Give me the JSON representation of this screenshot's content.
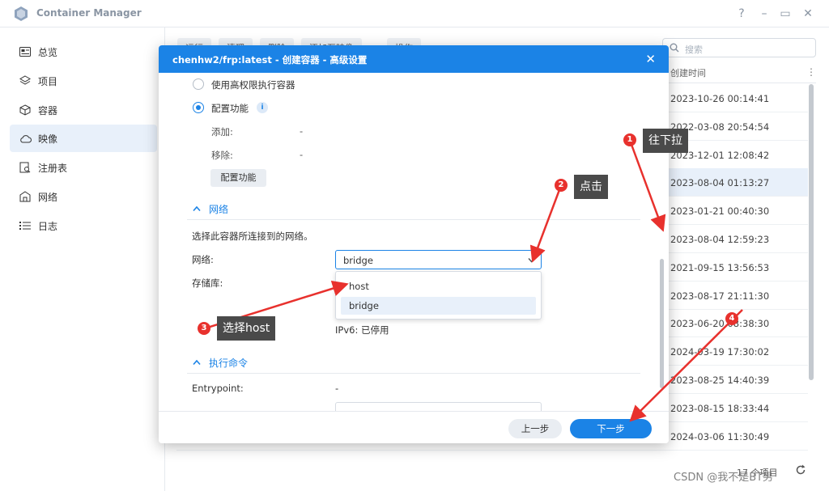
{
  "window": {
    "title": "Container Manager",
    "controls": [
      "?",
      "–",
      "▭",
      "✕"
    ]
  },
  "sidebar": {
    "items": [
      {
        "label": "总览",
        "icon": "overview-icon"
      },
      {
        "label": "项目",
        "icon": "layers-icon"
      },
      {
        "label": "容器",
        "icon": "cube-icon"
      },
      {
        "label": "映像",
        "icon": "cloud-icon"
      },
      {
        "label": "注册表",
        "icon": "registry-icon"
      },
      {
        "label": "网络",
        "icon": "network-icon"
      },
      {
        "label": "日志",
        "icon": "list-icon"
      }
    ],
    "active_index": 3
  },
  "toolbar": {
    "buttons": [
      "运行",
      "清理",
      "删除",
      "添加至映像",
      "操作"
    ]
  },
  "search": {
    "placeholder": "搜索"
  },
  "table": {
    "column_header": "创建时间",
    "more": "⋮",
    "rows": [
      "2023-10-26 00:14:41",
      "2022-03-08 20:54:54",
      "2023-12-01 12:08:42",
      "2023-08-04 01:13:27",
      "2023-01-21 00:40:30",
      "2023-08-04 12:59:23",
      "2021-09-15 13:56:53",
      "2023-08-17 21:11:30",
      "2023-06-20 08:38:30",
      "2024-03-19 17:30:02",
      "2023-08-25 14:40:39",
      "2023-08-15 18:33:44",
      "2024-03-06 11:30:49"
    ],
    "selected_row": 3,
    "footer": "17 个项目"
  },
  "dialog": {
    "title": "chenhw2/frp:latest - 创建容器 - 高级设置",
    "close": "✕",
    "privileged_label": "使用高权限执行容器",
    "capabilities_label": "配置功能",
    "add_label": "添加:",
    "add_value": "-",
    "remove_label": "移除:",
    "remove_value": "-",
    "capabilities_button": "配置功能",
    "network_section": "网络",
    "network_desc": "选择此容器所连接到的网络。",
    "network_label": "网络:",
    "network_value": "bridge",
    "options": [
      "host",
      "bridge"
    ],
    "storage_label": "存储库:",
    "ipv6": "IPv6: 已停用",
    "exec_section": "执行命令",
    "entrypoint_label": "Entrypoint:",
    "entrypoint_value": "-",
    "prev_button": "上一步",
    "next_button": "下一步"
  },
  "annotations": {
    "a1": {
      "num": "1",
      "text": "往下拉"
    },
    "a2": {
      "num": "2",
      "text": "点击"
    },
    "a3": {
      "num": "3",
      "text": "选择host"
    },
    "a4": {
      "num": "4"
    },
    "color": "#e8312d"
  },
  "watermark": "CSDN @我不是BT男"
}
